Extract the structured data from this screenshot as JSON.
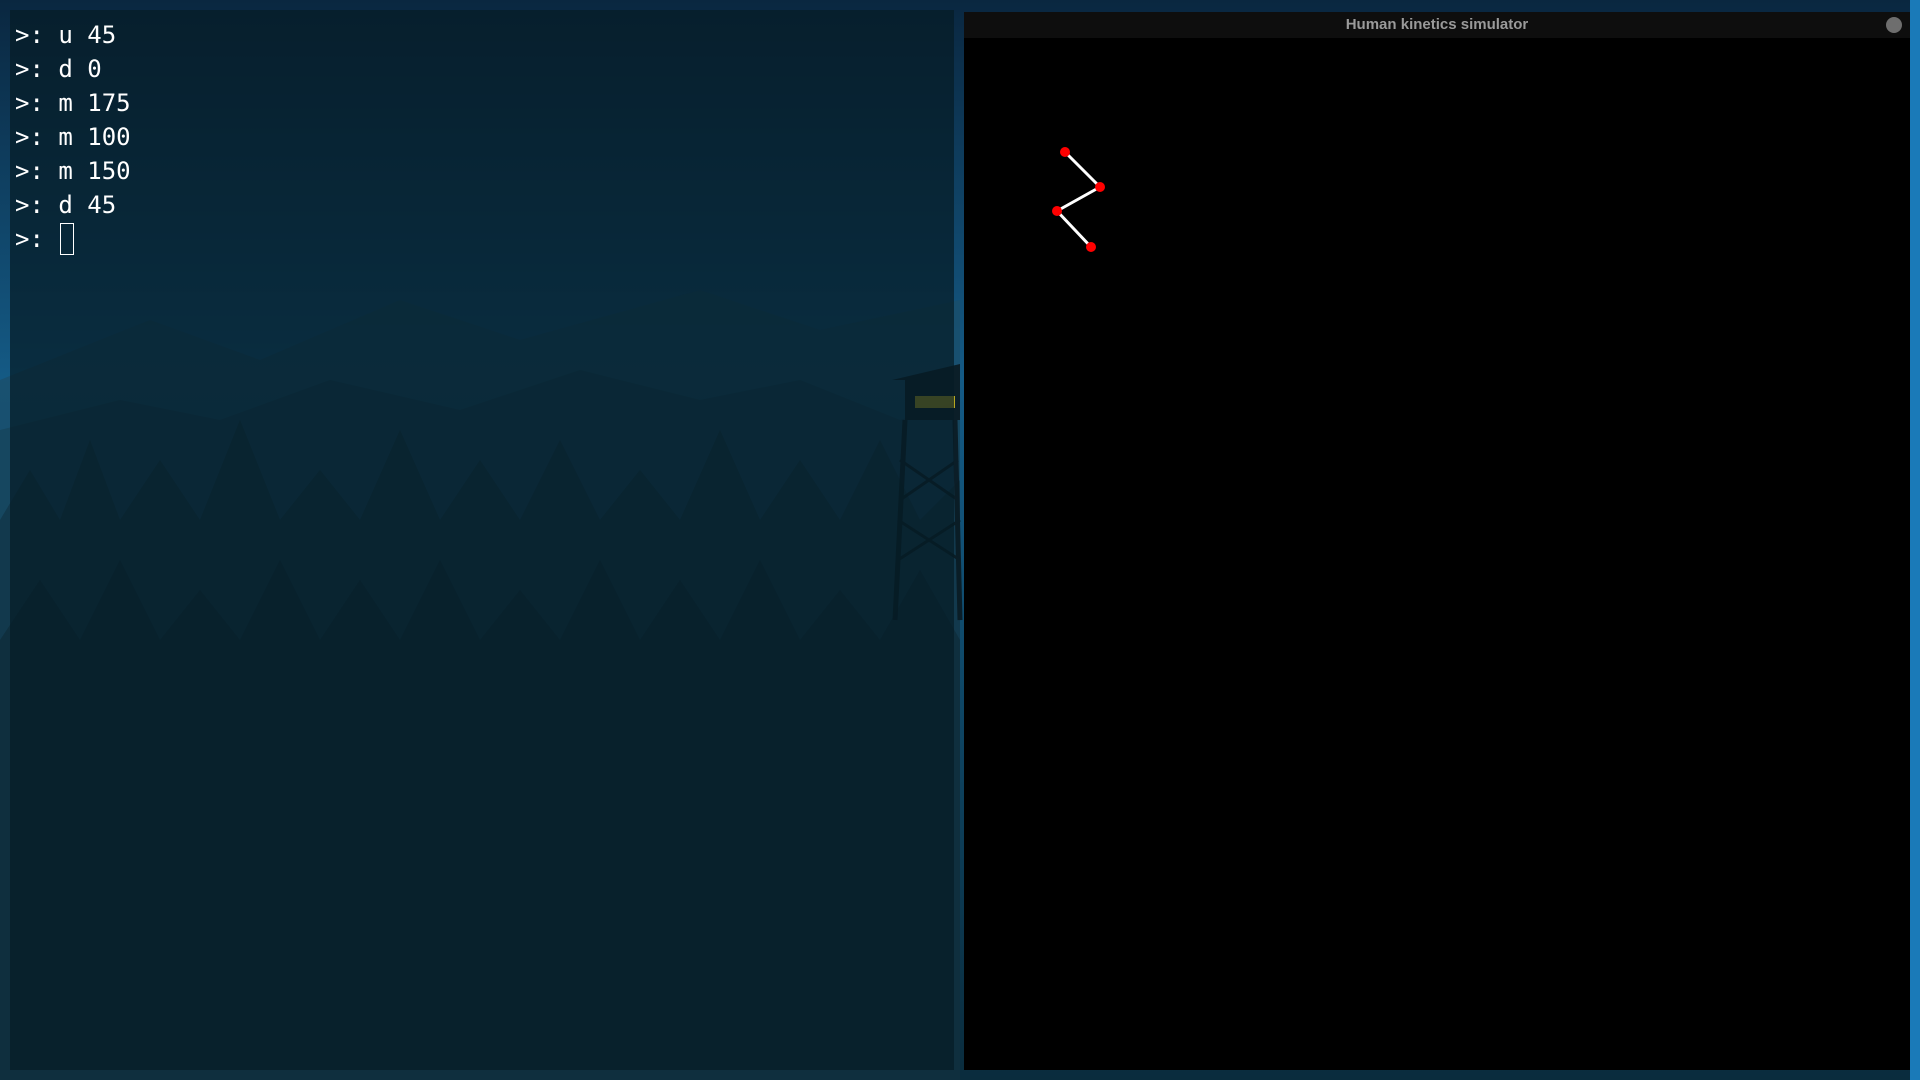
{
  "terminal": {
    "history": [
      ">: u 45",
      ">: d 0",
      ">: m 175",
      ">: m 100",
      ">: m 150",
      ">: d 45"
    ],
    "prompt": ">: ",
    "input_value": ""
  },
  "simulator": {
    "title": "Human kinetics simulator",
    "close_icon": "close-dot-icon",
    "figure": {
      "line_color": "#ffffff",
      "joint_color": "#ff0000"
    }
  },
  "wallpaper": {
    "description_icon": "firewatch-forest-wallpaper"
  }
}
